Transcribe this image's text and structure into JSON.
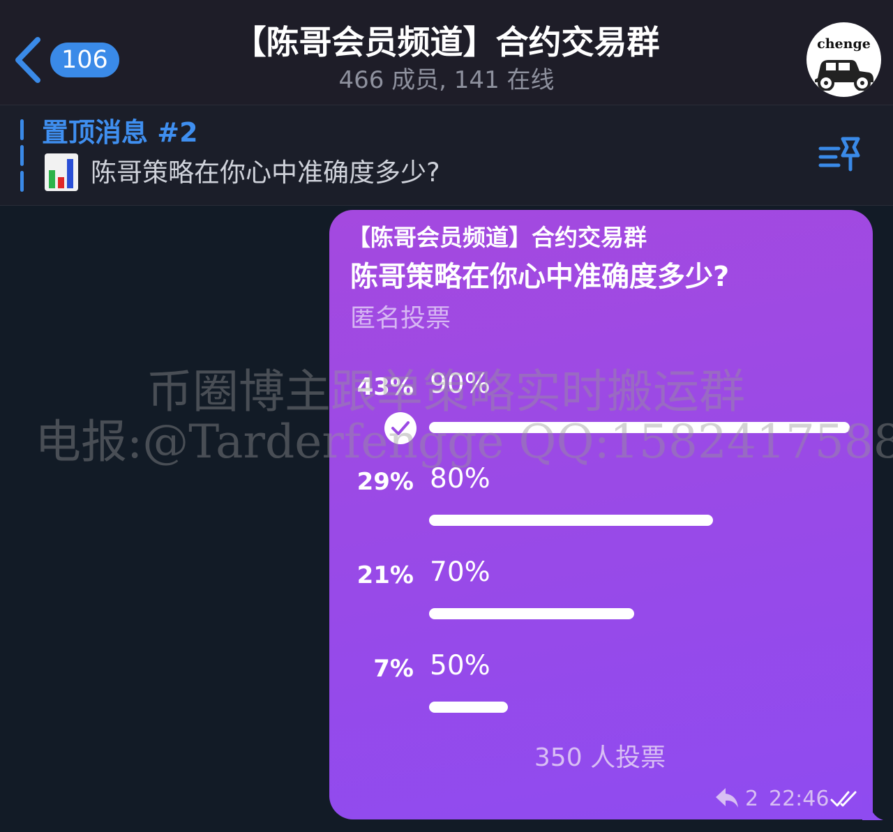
{
  "header": {
    "back_badge": "106",
    "title": "【陈哥会员频道】合约交易群",
    "subtitle": "466 成员, 141 在线",
    "avatar_text": "chenge"
  },
  "pinned": {
    "title": "置顶消息 #2",
    "text": "陈哥策略在你心中准确度多少?",
    "icon": "bar-chart-emoji"
  },
  "poll": {
    "source": "【陈哥会员频道】合约交易群",
    "question": "陈哥策略在你心中准确度多少?",
    "type": "匿名投票",
    "options": [
      {
        "percent": "43%",
        "label": "90%",
        "share": 43,
        "chosen": true
      },
      {
        "percent": "29%",
        "label": "80%",
        "share": 29,
        "chosen": false
      },
      {
        "percent": "21%",
        "label": "70%",
        "share": 21,
        "chosen": false
      },
      {
        "percent": "7%",
        "label": "50%",
        "share": 7,
        "chosen": false
      }
    ],
    "total": "350 人投票",
    "replies": "2",
    "time": "22:46"
  },
  "watermark": {
    "line1": "币圈博主跟单策略实时搬运群",
    "line2": "电报:@Tarderfengge QQ:1582417588"
  },
  "colors": {
    "accent": "#3a8ae8",
    "bubble": "#9a4ae6",
    "background": "#121b26"
  }
}
